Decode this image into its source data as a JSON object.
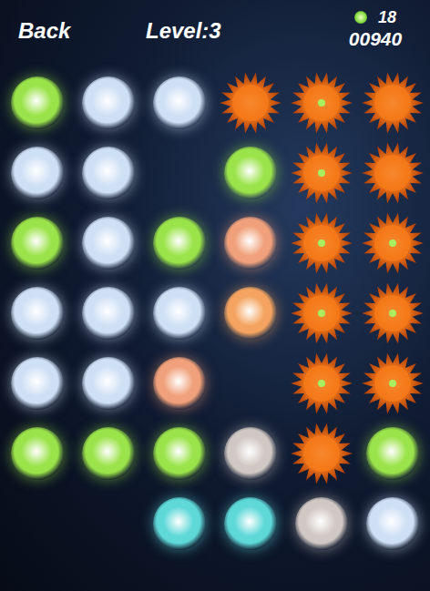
{
  "header": {
    "back": "Back",
    "level": "Level:3",
    "gems": "18",
    "score": "00940"
  },
  "grid": {
    "rows": [
      [
        {
          "kind": "orb",
          "color": "#9be34a"
        },
        {
          "kind": "orb",
          "color": "#cfe0f5"
        },
        {
          "kind": "orb",
          "color": "#cfe0f5"
        },
        {
          "kind": "burst",
          "color": "#f47a1a",
          "core": false
        },
        {
          "kind": "burst",
          "color": "#f47a1a",
          "core": true
        },
        {
          "kind": "burst",
          "color": "#f47a1a",
          "core": false
        }
      ],
      [
        {
          "kind": "orb",
          "color": "#cfe0f5"
        },
        {
          "kind": "orb",
          "color": "#cfe0f5"
        },
        {
          "kind": "empty"
        },
        {
          "kind": "orb",
          "color": "#9be34a"
        },
        {
          "kind": "burst",
          "color": "#f47a1a",
          "core": true
        },
        {
          "kind": "burst",
          "color": "#f47a1a",
          "core": false
        }
      ],
      [
        {
          "kind": "orb",
          "color": "#9be34a"
        },
        {
          "kind": "orb",
          "color": "#cfe0f5"
        },
        {
          "kind": "orb",
          "color": "#9be34a"
        },
        {
          "kind": "orb",
          "color": "#f0a07a"
        },
        {
          "kind": "burst",
          "color": "#f47a1a",
          "core": true
        },
        {
          "kind": "burst",
          "color": "#f47a1a",
          "core": true
        }
      ],
      [
        {
          "kind": "orb",
          "color": "#cfe0f5"
        },
        {
          "kind": "orb",
          "color": "#cfe0f5"
        },
        {
          "kind": "orb",
          "color": "#cfe0f5"
        },
        {
          "kind": "orb",
          "color": "#f4a460"
        },
        {
          "kind": "burst",
          "color": "#f47a1a",
          "core": true
        },
        {
          "kind": "burst",
          "color": "#f47a1a",
          "core": true
        }
      ],
      [
        {
          "kind": "orb",
          "color": "#cfe0f5"
        },
        {
          "kind": "orb",
          "color": "#cfe0f5"
        },
        {
          "kind": "orb",
          "color": "#f0a07a"
        },
        {
          "kind": "empty"
        },
        {
          "kind": "burst",
          "color": "#f47a1a",
          "core": true
        },
        {
          "kind": "burst",
          "color": "#f47a1a",
          "core": true
        }
      ],
      [
        {
          "kind": "orb",
          "color": "#9be34a"
        },
        {
          "kind": "orb",
          "color": "#9be34a"
        },
        {
          "kind": "orb",
          "color": "#9be34a"
        },
        {
          "kind": "orb",
          "color": "#d0c8c4"
        },
        {
          "kind": "burst",
          "color": "#f47a1a",
          "core": false
        },
        {
          "kind": "orb",
          "color": "#9be34a"
        }
      ],
      [
        {
          "kind": "empty"
        },
        {
          "kind": "empty"
        },
        {
          "kind": "orb",
          "color": "#5fd8d8"
        },
        {
          "kind": "orb",
          "color": "#5fd8d8"
        },
        {
          "kind": "orb",
          "color": "#d0c8c4"
        },
        {
          "kind": "orb",
          "color": "#cfe0f5"
        }
      ]
    ]
  }
}
